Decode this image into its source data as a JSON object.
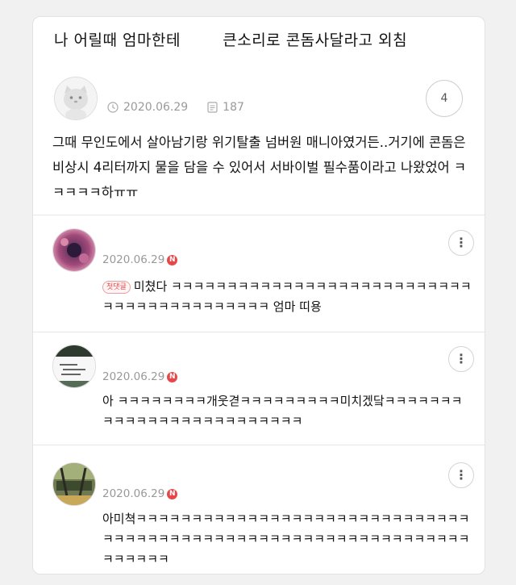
{
  "post": {
    "title": "나 어릴때 엄마한테        큰소리로 콘돔사달라고 외침",
    "date": "2020.06.29",
    "views": "187",
    "comment_count": "4",
    "body": "그때 무인도에서 살아남기랑 위기탈출 넘버원 매니아였거든..거기에 콘돔은 비상시 4리터까지 물을 담을 수 있어서 서바이벌 필수품이라고 나왔었어 ㅋㅋㅋㅋㅋ하ㅠㅠ"
  },
  "comments": [
    {
      "date": "2020.06.29",
      "badge": "N",
      "first_label": "첫댓글",
      "text": "미쳤다 ㅋㅋㅋㅋㅋㅋㅋㅋㅋㅋㅋㅋㅋㅋㅋㅋㅋㅋㅋㅋㅋㅋㅋㅋㅋㅋㅋㅋㅋㅋㅋㅋㅋㅋㅋㅋㅋㅋㅋㅋㅋㅋ 엄마 띠용"
    },
    {
      "date": "2020.06.29",
      "badge": "N",
      "text": "아       ㅋㅋㅋㅋㅋㅋㅋㅋ개웃겯ㅋㅋㅋㅋㅋㅋㅋㅋㅋ미치겠닼ㅋㅋㅋㅋㅋㅋㅋㅋㅋㅋㅋㅋㅋㅋㅋㅋㅋㅋㅋㅋㅋㅋㅋㅋㅋ"
    },
    {
      "date": "2020.06.29",
      "badge": "N",
      "text": "아미쳑ㅋㅋㅋㅋㅋㅋㅋㅋㅋㅋㅋㅋㅋㅋㅋㅋㅋㅋㅋㅋㅋㅋㅋㅋㅋㅋㅋㅋㅋㅋㅋㅋㅋㅋㅋㅋㅋㅋㅋㅋㅋㅋㅋㅋㅋㅋㅋㅋㅋㅋㅋㅋㅋㅋㅋㅋㅋㅋㅋㅋㅋㅋㅋㅋㅋㅋㅋㅋㅋ"
    }
  ],
  "icons": {
    "clock": "clock-icon",
    "views": "document-icon",
    "more": "kebab-icon"
  },
  "colors": {
    "new_badge": "#e8474a",
    "meta_text": "#9a9a9a"
  }
}
